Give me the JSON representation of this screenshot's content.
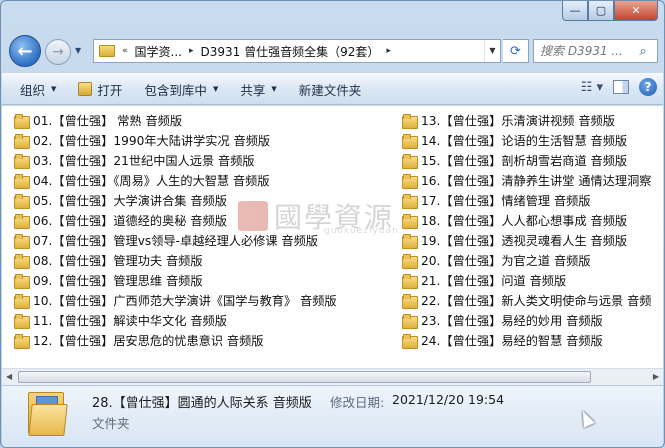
{
  "caption": {
    "minimize": "—",
    "maximize": "▢",
    "close": "✕"
  },
  "nav": {
    "back_glyph": "←",
    "forward_glyph": "→",
    "breadcrumb": [
      "«",
      "国学资...",
      "▸",
      "D3931 曾仕强音频全集（92套）",
      "▸"
    ],
    "search_placeholder": "搜索 D3931 ..."
  },
  "toolbar": {
    "organize": "组织",
    "open": "打开",
    "include": "包含到库中",
    "share": "共享",
    "new_folder": "新建文件夹"
  },
  "files_left": [
    "01.【曾仕强】 常熟 音频版",
    "02.【曾仕强】1990年大陆讲学实况 音频版",
    "03.【曾仕强】21世纪中国人远景 音频版",
    "04.【曾仕强】《周易》人生的大智慧 音频版",
    "05.【曾仕强】大学演讲合集 音频版",
    "06.【曾仕强】道德经的奥秘 音频版",
    "07.【曾仕强】管理vs领导-卓越经理人必修课 音频版",
    "08.【曾仕强】管理功夫 音频版",
    "09.【曾仕强】管理思维 音频版",
    "10.【曾仕强】广西师范大学演讲《国学与教育》 音频版",
    "11.【曾仕强】解读中华文化 音频版",
    "12.【曾仕强】居安思危的忧患意识 音频版"
  ],
  "files_right": [
    "13.【曾仕强】乐清演讲视频 音频版",
    "14.【曾仕强】论语的生活智慧 音频版",
    "15.【曾仕强】剖析胡雪岩商道 音频版",
    "16.【曾仕强】清静养生讲堂 通情达理洞察",
    "17.【曾仕强】情绪管理 音频版",
    "18.【曾仕强】人人都心想事成 音频版",
    "19.【曾仕强】透视灵魂看人生 音频版",
    "20.【曾仕强】为官之道 音频版",
    "21.【曾仕强】问道 音频版",
    "22.【曾仕强】新人类文明使命与远景 音频",
    "23.【曾仕强】易经的妙用 音频版",
    "24.【曾仕强】易经的智慧 音频版"
  ],
  "watermark": {
    "text": "國學資源",
    "sub": "guoxueziyuan"
  },
  "details": {
    "name": "28.【曾仕强】圆通的人际关系 音频版",
    "modified_label": "修改日期:",
    "modified_value": "2021/12/20 19:54",
    "type": "文件夹"
  },
  "colors": {
    "folder": "#f0c454",
    "accent": "#2f6fc2",
    "close": "#c4432d"
  }
}
